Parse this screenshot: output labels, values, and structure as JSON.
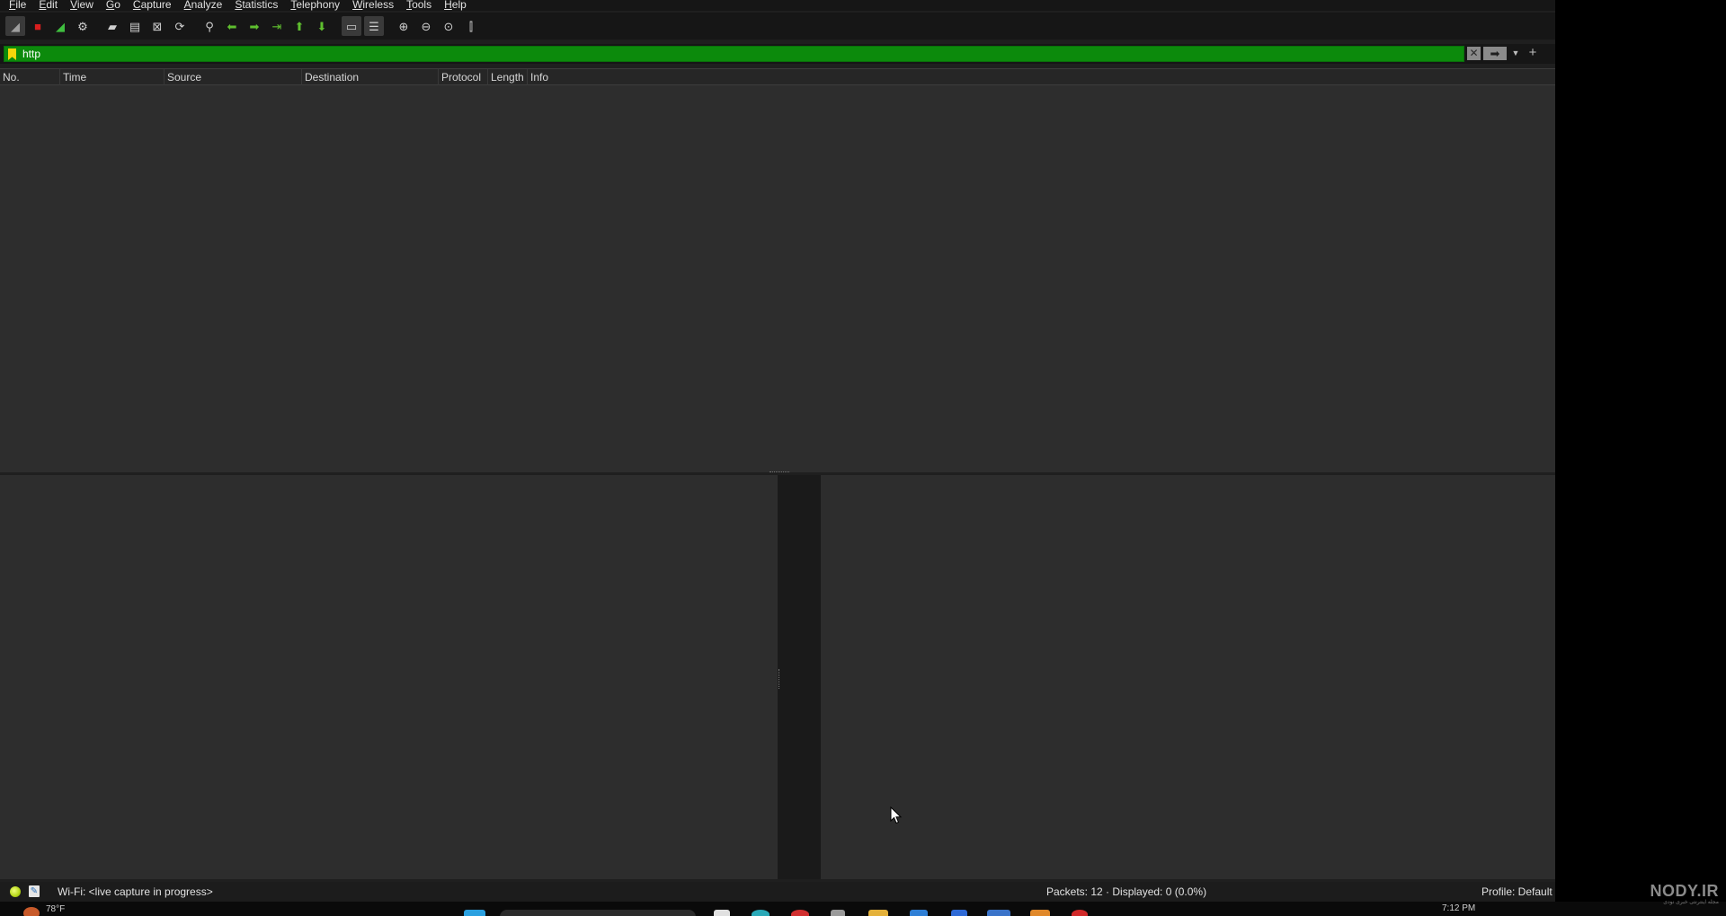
{
  "menu": [
    "File",
    "Edit",
    "View",
    "Go",
    "Capture",
    "Analyze",
    "Statistics",
    "Telephony",
    "Wireless",
    "Tools",
    "Help"
  ],
  "toolbar": {
    "buttons": [
      {
        "name": "start-capture-icon",
        "glyph": "◢",
        "color": "#9e9e9e",
        "active": true
      },
      {
        "name": "stop-capture-icon",
        "glyph": "■",
        "color": "#d81e1e",
        "active": false
      },
      {
        "name": "restart-capture-icon",
        "glyph": "◢",
        "color": "#3fbf3f",
        "active": false
      },
      {
        "name": "capture-options-icon",
        "glyph": "⚙",
        "color": "#cfcfcf",
        "active": false
      },
      {
        "name": "open-file-icon",
        "glyph": "▰",
        "color": "#cfcfcf",
        "active": false
      },
      {
        "name": "save-file-icon",
        "glyph": "▤",
        "color": "#cfcfcf",
        "active": false
      },
      {
        "name": "close-file-icon",
        "glyph": "⊠",
        "color": "#cfcfcf",
        "active": false
      },
      {
        "name": "reload-file-icon",
        "glyph": "⟳",
        "color": "#cfcfcf",
        "active": false
      },
      {
        "name": "find-packet-icon",
        "glyph": "⚲",
        "color": "#cfcfcf",
        "active": false
      },
      {
        "name": "go-back-icon",
        "glyph": "⬅",
        "color": "#5fbf2f",
        "active": false
      },
      {
        "name": "go-forward-icon",
        "glyph": "➡",
        "color": "#5fbf2f",
        "active": false
      },
      {
        "name": "go-to-packet-icon",
        "glyph": "⇥",
        "color": "#5fbf2f",
        "active": false
      },
      {
        "name": "go-first-packet-icon",
        "glyph": "⬆",
        "color": "#5fbf2f",
        "active": false
      },
      {
        "name": "go-last-packet-icon",
        "glyph": "⬇",
        "color": "#5fbf2f",
        "active": false
      },
      {
        "name": "auto-scroll-icon",
        "glyph": "▭",
        "color": "#cfcfcf",
        "active": true
      },
      {
        "name": "colorize-icon",
        "glyph": "☰",
        "color": "#cfcfcf",
        "active": true
      },
      {
        "name": "zoom-in-icon",
        "glyph": "⊕",
        "color": "#cfcfcf",
        "active": false
      },
      {
        "name": "zoom-out-icon",
        "glyph": "⊖",
        "color": "#cfcfcf",
        "active": false
      },
      {
        "name": "zoom-normal-icon",
        "glyph": "⊙",
        "color": "#cfcfcf",
        "active": false
      },
      {
        "name": "resize-columns-icon",
        "glyph": "⫿",
        "color": "#cfcfcf",
        "active": false
      }
    ]
  },
  "filter": {
    "value": "http",
    "color": "#0c8a0c"
  },
  "packet_list": {
    "columns": [
      "No.",
      "Time",
      "Source",
      "Destination",
      "Protocol",
      "Length",
      "Info"
    ]
  },
  "status": {
    "interface": "Wi-Fi: <live capture in progress>",
    "packets": "Packets: 12 · Displayed: 0 (0.0%)",
    "profile": "Profile: Default"
  },
  "taskbar": {
    "weather": "78°F",
    "clock": "7:12 PM"
  },
  "watermark": {
    "logo": "NODY.IR",
    "tagline": "مجله اینترنتی خبری نودی"
  }
}
